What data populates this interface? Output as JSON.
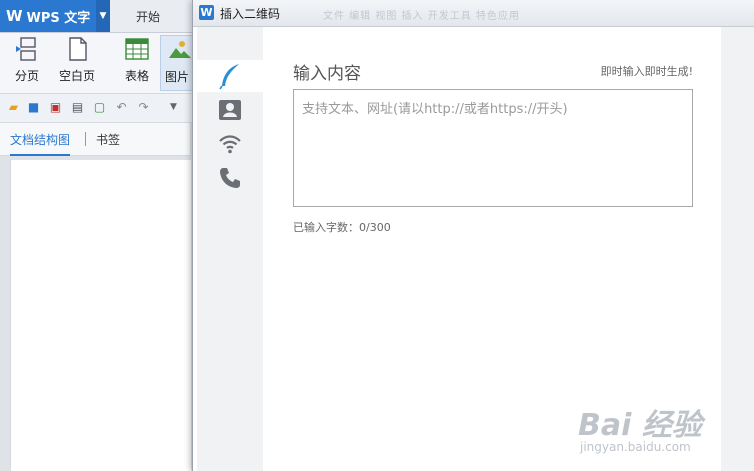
{
  "wps": {
    "app_name": "WPS 文字",
    "tabs": [
      "开始"
    ],
    "ribbon": {
      "page_break": "分页",
      "blank_page": "空白页",
      "table": "表格",
      "picture": "图片"
    },
    "nav_tabs": {
      "doc_structure": "文档结构图",
      "bookmarks": "书签"
    }
  },
  "dialog": {
    "title": "插入二维码",
    "ghost_tabs": "文件  编辑  视图  插入  开发工具  特色应用",
    "sidebar": [
      {
        "icon": "feather-icon",
        "active": true
      },
      {
        "icon": "contact-card-icon",
        "active": false
      },
      {
        "icon": "wifi-icon",
        "active": false
      },
      {
        "icon": "phone-icon",
        "active": false
      }
    ],
    "heading": "输入内容",
    "hint": "即时输入即时生成!",
    "input": {
      "value": "",
      "placeholder": "支持文本、网址(请以http://或者https://开头)"
    },
    "char_count": "已输入字数：0/300"
  },
  "watermark": {
    "main": "Bai 经验",
    "sub": "jingyan.baidu.com"
  },
  "colors": {
    "accent": "#2b78d0",
    "feather": "#2b8fd8",
    "sidebar_icon": "#6b6f75"
  }
}
